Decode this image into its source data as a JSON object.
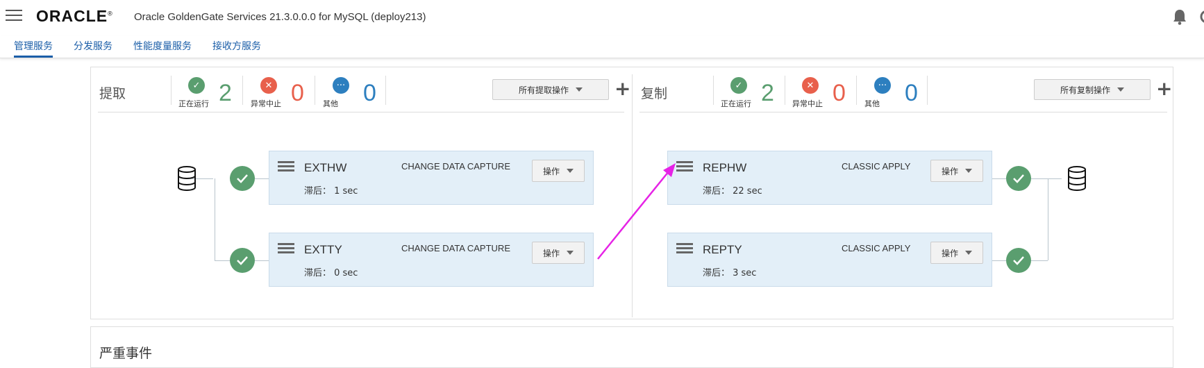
{
  "header": {
    "logo": "ORACLE",
    "logo_mark": "®",
    "title": "Oracle GoldenGate Services 21.3.0.0.0 for MySQL (deploy213)"
  },
  "tabs": [
    {
      "label": "管理服务",
      "active": true
    },
    {
      "label": "分发服务",
      "active": false
    },
    {
      "label": "性能度量服务",
      "active": false
    },
    {
      "label": "接收方服务",
      "active": false
    }
  ],
  "extract": {
    "title": "提取",
    "stats": [
      {
        "label": "正在运行",
        "value": "2",
        "color": "#5a9e6f",
        "icon": "check-icon"
      },
      {
        "label": "异常中止",
        "value": "0",
        "color": "#e8604c",
        "icon": "x-icon"
      },
      {
        "label": "其他",
        "value": "0",
        "color": "#2d7fbf",
        "icon": "ellipsis-icon"
      }
    ],
    "actions_label": "所有提取操作",
    "processes": [
      {
        "name": "EXTHW",
        "type": "CHANGE DATA CAPTURE",
        "lag": "滞后： 1 sec",
        "button": "操作"
      },
      {
        "name": "EXTTY",
        "type": "CHANGE DATA CAPTURE",
        "lag": "滞后： 0 sec",
        "button": "操作"
      }
    ]
  },
  "replicat": {
    "title": "复制",
    "stats": [
      {
        "label": "正在运行",
        "value": "2",
        "color": "#5a9e6f",
        "icon": "check-icon"
      },
      {
        "label": "异常中止",
        "value": "0",
        "color": "#e8604c",
        "icon": "x-icon"
      },
      {
        "label": "其他",
        "value": "0",
        "color": "#2d7fbf",
        "icon": "ellipsis-icon"
      }
    ],
    "actions_label": "所有复制操作",
    "processes": [
      {
        "name": "REPHW",
        "type": "CLASSIC APPLY",
        "lag": "滞后： 22 sec",
        "button": "操作"
      },
      {
        "name": "REPTY",
        "type": "CLASSIC APPLY",
        "lag": "滞后： 3 sec",
        "button": "操作"
      }
    ]
  },
  "events": {
    "title": "严重事件"
  },
  "colors": {
    "accent": "#1b5ea8",
    "card_bg": "#e3eff8",
    "annotation_arrow": "#e623e6"
  }
}
